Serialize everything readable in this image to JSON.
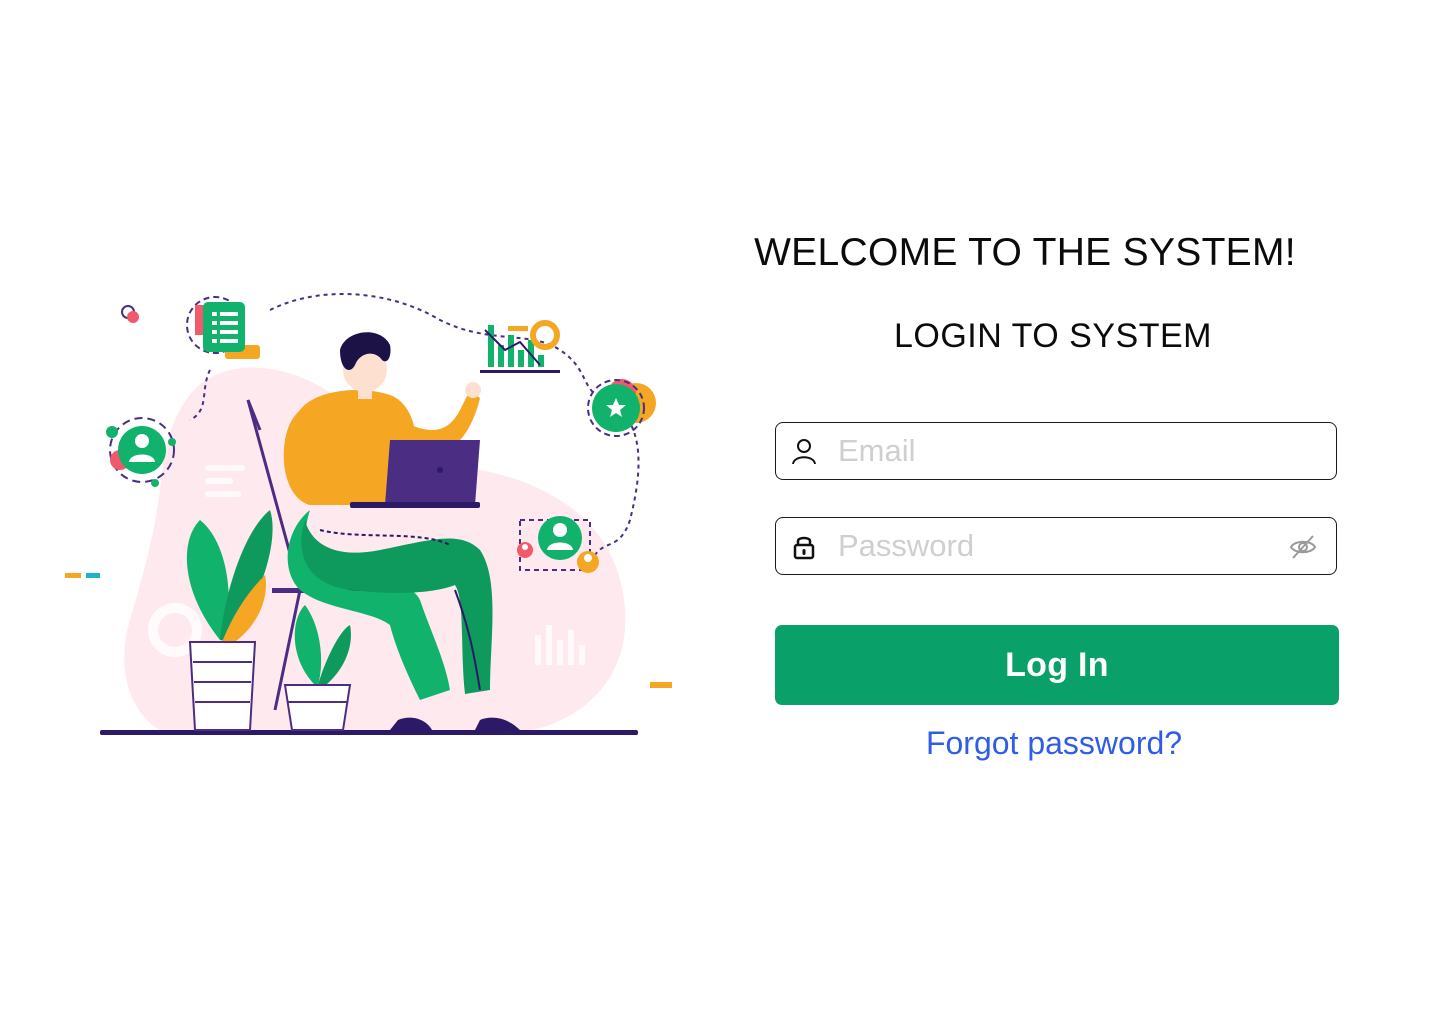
{
  "header": {
    "welcome_title": "WELCOME TO THE SYSTEM!",
    "login_subtitle": "LOGIN TO SYSTEM"
  },
  "form": {
    "email": {
      "placeholder": "Email",
      "value": "",
      "icon": "user-icon"
    },
    "password": {
      "placeholder": "Password",
      "value": "",
      "icon": "lock-icon",
      "toggle_icon": "eye-slash-icon"
    },
    "submit_label": "Log In",
    "forgot_label": "Forgot password?"
  },
  "colors": {
    "primary_button": "#0aa06a",
    "link": "#2f5de8",
    "illustration_green": "#10b26c",
    "illustration_orange": "#f5a623",
    "illustration_purple": "#4b2e83",
    "illustration_pink_blob": "#fde9ee"
  }
}
